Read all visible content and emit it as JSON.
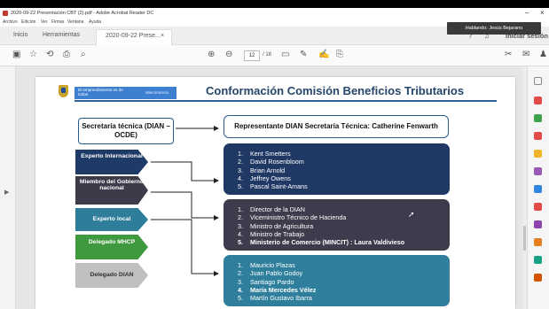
{
  "window": {
    "title": "2020-09-22 Presentación CBT (2).pdf - Adobe Acrobat Reader DC",
    "speaking_label": "Hablando: Jesús Bejarano"
  },
  "menu": [
    "Archivo",
    "Edición",
    "Ver",
    "Firmar",
    "Ventana",
    "Ayuda"
  ],
  "tabs": {
    "home": "Inicio",
    "tools": "Herramientas",
    "document": "2020-09-22 Prese...",
    "signin": "Iniciar sesión"
  },
  "toolbar": {
    "page_current": "12",
    "page_total": "/ 18"
  },
  "slide": {
    "banner_text": "El emprendimiento es de todos",
    "banner_right": "Mincomercio",
    "title": "Conformación Comisión Beneficios Tributarios",
    "secretaria": "Secretaría técnica (DIAN – OCDE)",
    "representante": "Representante DIAN Secretaría Técnica: Catherine Fenwarth",
    "chevrons": [
      {
        "label": "Experto Internacional",
        "color": "#1e3a66"
      },
      {
        "label": "Miembro del Gobierno nacional",
        "color": "#3b3b4a"
      },
      {
        "label": "Experto local",
        "color": "#2e7d9a"
      },
      {
        "label": "Delegado MHCP",
        "color": "#3f9a3f"
      },
      {
        "label": "Delegado DIAN",
        "color": "#bfbfbf"
      }
    ],
    "panels": [
      {
        "color": "#1f3864",
        "items": [
          {
            "n": "1.",
            "text": "Kent Smetters",
            "bold": false
          },
          {
            "n": "2.",
            "text": "David Rosenbloom",
            "bold": false
          },
          {
            "n": "3.",
            "text": "Brian Arnold",
            "bold": false
          },
          {
            "n": "4.",
            "text": "Jeffrey Owens",
            "bold": false
          },
          {
            "n": "5.",
            "text": "Pascal Saint-Amans",
            "bold": false
          }
        ]
      },
      {
        "color": "#3c3c4c",
        "items": [
          {
            "n": "1.",
            "text": "Director de la DIAN",
            "bold": false
          },
          {
            "n": "2.",
            "text": "Viceministro Técnico de Hacienda",
            "bold": false
          },
          {
            "n": "3.",
            "text": "Ministro de Agricultura",
            "bold": false
          },
          {
            "n": "4.",
            "text": "Ministro de Trabajo",
            "bold": false
          },
          {
            "n": "5.",
            "text": "Ministerio de Comercio (MINCIT) : Laura Valdivieso",
            "bold": true
          }
        ]
      },
      {
        "color": "#2f7f9c",
        "items": [
          {
            "n": "1.",
            "text": "Mauricio Plazas",
            "bold": false
          },
          {
            "n": "2.",
            "text": "Juan Pablo Godoy",
            "bold": false
          },
          {
            "n": "3.",
            "text": "Santiago Pardo",
            "bold": false
          },
          {
            "n": "4.",
            "text": "María Mercedes Vélez",
            "bold": true
          },
          {
            "n": "5.",
            "text": "Martín Gustavo Ibarra",
            "bold": false
          }
        ]
      }
    ]
  }
}
